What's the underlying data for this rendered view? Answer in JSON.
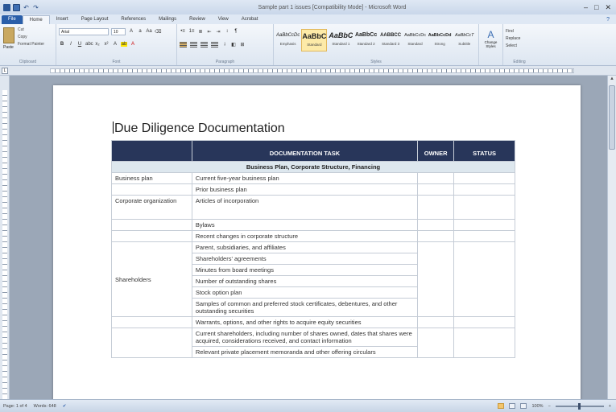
{
  "window": {
    "title": "Sample part 1 issues [Compatibility Mode] - Microsoft Word",
    "controls": [
      "–",
      "□",
      "✕"
    ]
  },
  "ribbon_tabs": [
    "File",
    "Home",
    "Insert",
    "Page Layout",
    "References",
    "Mailings",
    "Review",
    "View",
    "Acrobat"
  ],
  "clipboard": {
    "paste": "Paste",
    "cut": "Cut",
    "copy": "Copy",
    "format_painter": "Format Painter",
    "label": "Clipboard"
  },
  "font_group": {
    "font_name": "Arial",
    "font_size": "10",
    "label": "Font"
  },
  "paragraph_group": {
    "label": "Paragraph"
  },
  "styles_group": {
    "label": "Styles",
    "items": [
      {
        "sample": "AaBbCcDc",
        "name": "Emphasis"
      },
      {
        "sample": "AaBbC",
        "name": "Standard"
      },
      {
        "sample": "AaBbC",
        "name": "Standard 1"
      },
      {
        "sample": "AaBbCc",
        "name": "Standard 2"
      },
      {
        "sample": "AABBCC",
        "name": "Standard 3"
      },
      {
        "sample": "AaBbCcDc",
        "name": "Standard"
      },
      {
        "sample": "AaBbCcDd",
        "name": "Strong"
      },
      {
        "sample": "AaBbCcT",
        "name": "Subtitle"
      }
    ],
    "change_styles": "Change Styles"
  },
  "editing_group": {
    "find": "Find",
    "replace": "Replace",
    "select": "Select",
    "label": "Editing"
  },
  "document": {
    "title": "Due Diligence Documentation",
    "table": {
      "headers": [
        "",
        "DOCUMENTATION TASK",
        "OWNER",
        "STATUS"
      ],
      "section": "Business Plan, Corporate Structure, Financing",
      "rows": [
        {
          "category": "Business plan",
          "task": "Current five-year business plan"
        },
        {
          "category": "",
          "task": "Prior business plan"
        },
        {
          "category": "Corporate organization",
          "task": "Articles of incorporation"
        },
        {
          "category": "",
          "task": "Bylaws"
        },
        {
          "category": "",
          "task": "Recent changes in corporate structure"
        },
        {
          "category": "",
          "task": "Parent, subsidiaries, and affiliates"
        },
        {
          "category": "",
          "task": "Shareholders' agreements"
        },
        {
          "category": "",
          "task": "Minutes from board meetings"
        },
        {
          "category": "Shareholders",
          "task": "Number of outstanding shares"
        },
        {
          "category": "",
          "task": "Stock option plan"
        },
        {
          "category": "",
          "task": "Samples of common and preferred stock certificates, debentures, and other outstanding securities"
        },
        {
          "category": "",
          "task": "Warrants, options, and other rights to acquire equity securities"
        },
        {
          "category": "",
          "task": "Current shareholders, including number of shares owned, dates that shares were acquired, considerations received, and contact information"
        },
        {
          "category": "",
          "task": "Relevant private placement memoranda and other offering circulars"
        }
      ]
    }
  },
  "status_bar": {
    "page": "Page: 1 of 4",
    "words": "Words: 648",
    "zoom": "100%"
  }
}
